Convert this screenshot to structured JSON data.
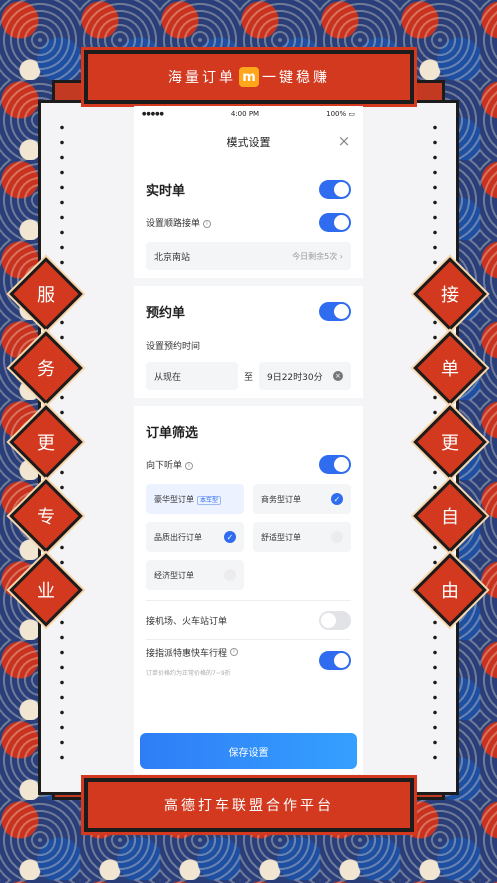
{
  "top_banner": {
    "text_before": "海量订单",
    "logo_letter": "m",
    "text_after": "一键稳赚"
  },
  "bottom_banner": {
    "text": "高德打车联盟合作平台"
  },
  "left_slogan": [
    "服",
    "务",
    "更",
    "专",
    "业"
  ],
  "right_slogan": [
    "接",
    "单",
    "更",
    "自",
    "由"
  ],
  "status_bar": {
    "signal": "●●●●●",
    "time": "4:00 PM",
    "battery": "100%"
  },
  "modal": {
    "title": "模式设置",
    "close": "×"
  },
  "realtime": {
    "title": "实时单",
    "toggle_on": true,
    "route_label": "设置顺路接单",
    "route_on": true,
    "station": "北京南站",
    "remaining": "今日剩余5次"
  },
  "reservation": {
    "title": "预约单",
    "toggle_on": true,
    "time_label": "设置预约时间",
    "from": "从现在",
    "to_word": "至",
    "until": "9日22时30分"
  },
  "filter": {
    "title": "订单筛选",
    "down_label": "向下听单",
    "down_on": true,
    "options": [
      {
        "label": "豪华型订单",
        "tag": "本车型",
        "checked": false,
        "selected": true
      },
      {
        "label": "商务型订单",
        "tag": "",
        "checked": true,
        "selected": false
      },
      {
        "label": "品质出行订单",
        "tag": "",
        "checked": true,
        "selected": false
      },
      {
        "label": "舒适型订单",
        "tag": "",
        "checked": false,
        "selected": false
      },
      {
        "label": "经济型订单",
        "tag": "",
        "checked": false,
        "selected": false
      }
    ],
    "airport_label": "接机场、火车站订单",
    "airport_on": false,
    "express_label": "接指派特惠快车行程",
    "express_note": "订单价格约为正常价格的7~9折",
    "express_on": true
  },
  "save_button": "保存设置",
  "colors": {
    "accent": "#2f6cf0",
    "banner_red": "#d2391f"
  }
}
